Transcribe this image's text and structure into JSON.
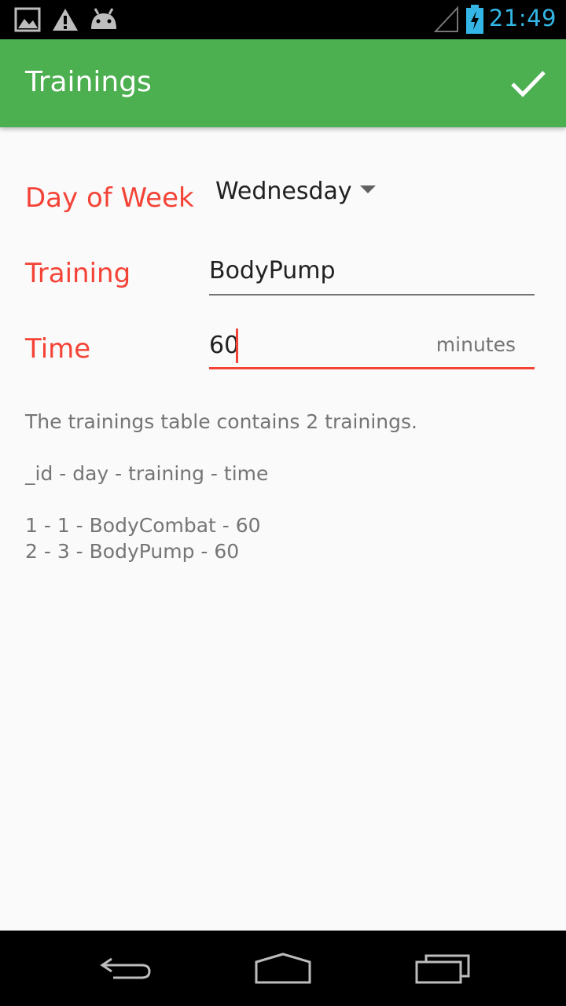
{
  "status_bar": {
    "time": "21:49",
    "icons": [
      "image-notification-icon",
      "warning-notification-icon",
      "android-debug-icon",
      "signal-icon",
      "battery-charging-icon"
    ]
  },
  "app_bar": {
    "title": "Trainings",
    "confirm_icon": "check-icon"
  },
  "form": {
    "day_label": "Day of Week",
    "day_value": "Wednesday",
    "training_label": "Training",
    "training_value": "BodyPump",
    "time_label": "Time",
    "time_value": "60",
    "time_units": "minutes"
  },
  "info": {
    "summary": "The trainings table contains 2 trainings.",
    "header": "_id - day - training - time",
    "rows": [
      "1 - 1 - BodyCombat - 60",
      "2 - 3 - BodyPump - 60"
    ]
  },
  "nav_bar": {
    "buttons": [
      "back-icon",
      "home-icon",
      "recents-icon"
    ]
  },
  "colors": {
    "app_bar": "#4caf50",
    "accent": "#f44336",
    "status_time": "#33b5e5",
    "background": "#fafafa"
  }
}
